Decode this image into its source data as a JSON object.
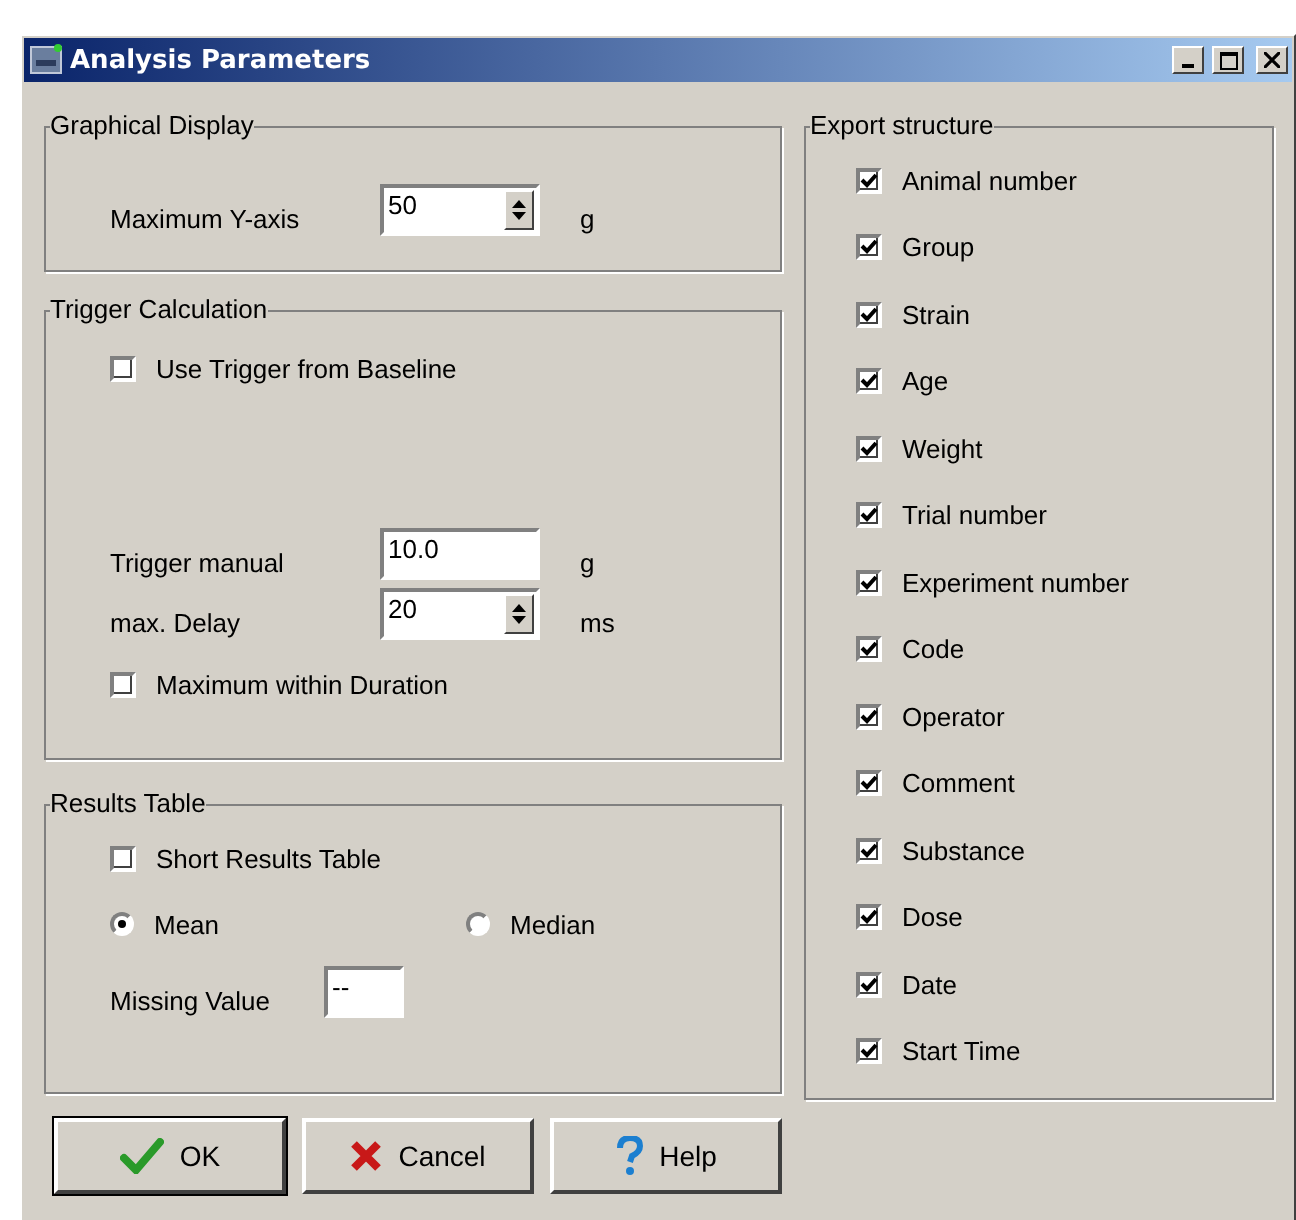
{
  "window": {
    "title": "Analysis Parameters"
  },
  "graphical_display": {
    "title": "Graphical Display",
    "max_y": {
      "label": "Maximum Y-axis",
      "value": "50",
      "unit": "g"
    }
  },
  "trigger_calculation": {
    "title": "Trigger Calculation",
    "use_baseline": {
      "label": "Use Trigger from Baseline",
      "checked": false
    },
    "trigger_manual": {
      "label": "Trigger manual",
      "value": "10.0",
      "unit": "g"
    },
    "max_delay": {
      "label": "max. Delay",
      "value": "20",
      "unit": "ms"
    },
    "max_within_duration": {
      "label": "Maximum within Duration",
      "checked": false
    }
  },
  "results_table": {
    "title": "Results Table",
    "short_table": {
      "label": "Short Results Table",
      "checked": false
    },
    "statistic": [
      {
        "label": "Mean",
        "selected": true
      },
      {
        "label": "Median",
        "selected": false
      }
    ],
    "missing_value": {
      "label": "Missing Value",
      "value": "--"
    }
  },
  "export_structure": {
    "title": "Export structure",
    "items": [
      {
        "label": "Animal number",
        "checked": true
      },
      {
        "label": "Group",
        "checked": true
      },
      {
        "label": "Strain",
        "checked": true
      },
      {
        "label": "Age",
        "checked": true
      },
      {
        "label": "Weight",
        "checked": true
      },
      {
        "label": "Trial number",
        "checked": true
      },
      {
        "label": "Experiment number",
        "checked": true
      },
      {
        "label": "Code",
        "checked": true
      },
      {
        "label": "Operator",
        "checked": true
      },
      {
        "label": "Comment",
        "checked": true
      },
      {
        "label": "Substance",
        "checked": true
      },
      {
        "label": "Dose",
        "checked": true
      },
      {
        "label": "Date",
        "checked": true
      },
      {
        "label": "Start Time",
        "checked": true
      }
    ]
  },
  "buttons": [
    {
      "kind": "ok",
      "label": "OK"
    },
    {
      "kind": "cancel",
      "label": "Cancel"
    },
    {
      "kind": "help",
      "label": "Help"
    }
  ]
}
